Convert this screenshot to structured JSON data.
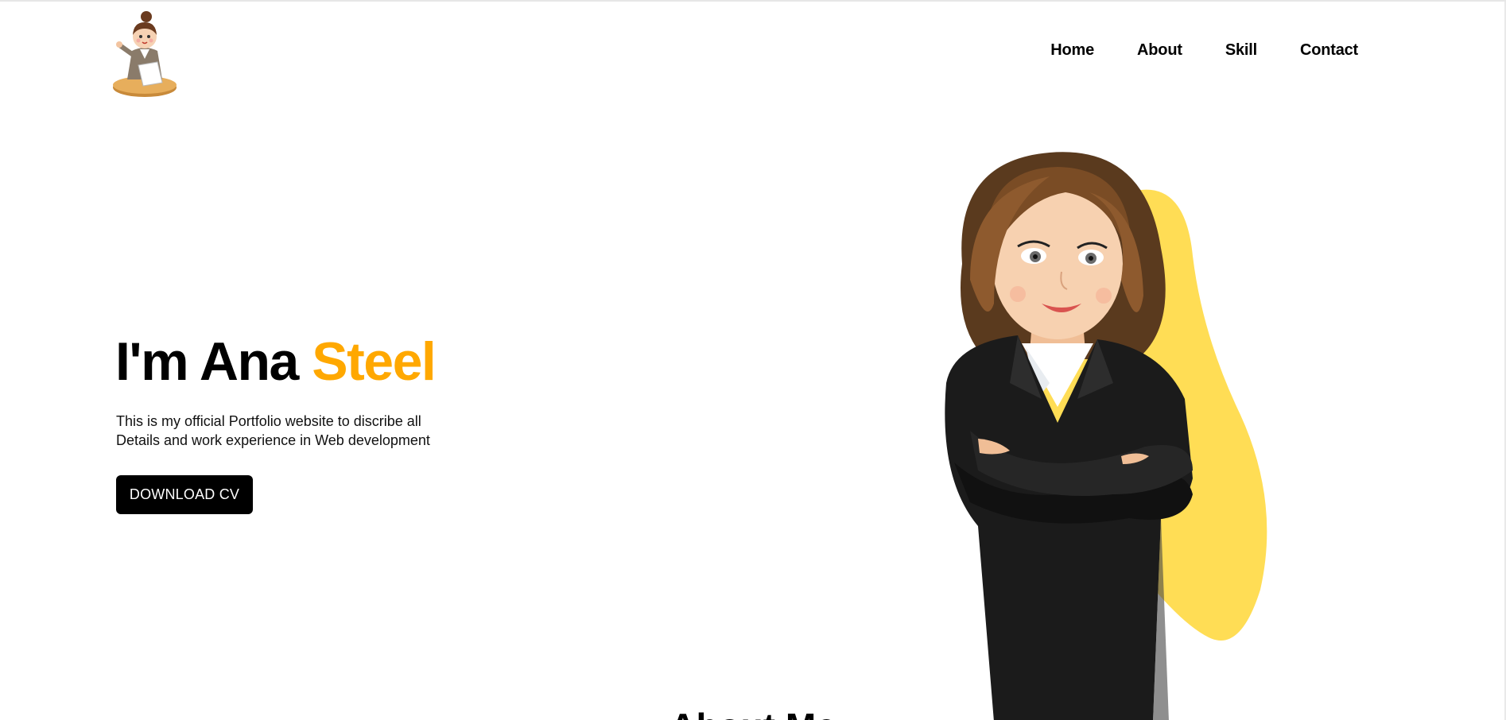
{
  "header": {
    "logo_alt": "girl-at-desk-logo",
    "nav": [
      {
        "label": "Home"
      },
      {
        "label": "About"
      },
      {
        "label": "Skill"
      },
      {
        "label": "Contact"
      }
    ]
  },
  "hero": {
    "title_prefix": "I'm Ana ",
    "title_accent": "Steel",
    "description": "This is my official Portfolio website to discribe all Details and work experience in Web development",
    "cta_label": "DOWNLOAD CV",
    "illustration": "businesswoman-crossed-arms-illustration"
  },
  "next_section": {
    "title": "About Me"
  },
  "colors": {
    "accent": "#FFA800",
    "blob": "#FFDD55",
    "button_bg": "#000000",
    "text": "#000000"
  }
}
